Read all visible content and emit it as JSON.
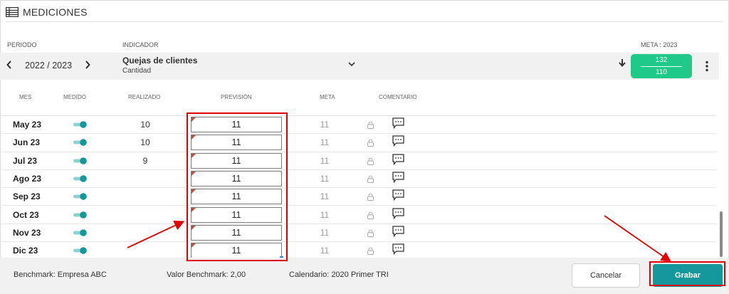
{
  "header": {
    "title": "MEDICIONES",
    "icon": "list-table-icon"
  },
  "labels": {
    "periodo": "PERIODO",
    "indicador": "INDICADOR",
    "meta": "META : 2023"
  },
  "selector": {
    "period": "2022 / 2023",
    "indicator_name": "Quejas de clientes",
    "indicator_unit": "Cantidad",
    "meta_top": "132",
    "meta_bottom": "110"
  },
  "columns": {
    "mes": "MES",
    "medido": "MEDIDO",
    "realizado": "REALIZADO",
    "prevision": "PREVISIÓN",
    "meta": "META",
    "comentario": "COMENTARIO"
  },
  "rows": [
    {
      "mes": "May 23",
      "realizado": "10",
      "prevision": "11",
      "meta": "11"
    },
    {
      "mes": "Jun 23",
      "realizado": "10",
      "prevision": "11",
      "meta": "11"
    },
    {
      "mes": "Jul 23",
      "realizado": "9",
      "prevision": "11",
      "meta": "11"
    },
    {
      "mes": "Ago 23",
      "realizado": "",
      "prevision": "11",
      "meta": "11"
    },
    {
      "mes": "Sep 23",
      "realizado": "",
      "prevision": "11",
      "meta": "11"
    },
    {
      "mes": "Oct 23",
      "realizado": "",
      "prevision": "11",
      "meta": "11"
    },
    {
      "mes": "Nov 23",
      "realizado": "",
      "prevision": "11",
      "meta": "11"
    },
    {
      "mes": "Dic 23",
      "realizado": "",
      "prevision": "11",
      "meta": "11"
    }
  ],
  "footer": {
    "benchmark": "Benchmark: Empresa ABC",
    "valor_benchmark": "Valor Benchmark: 2,00",
    "calendario": "Calendario:   2020 Primer TRI",
    "cancel": "Cancelar",
    "save": "Grabar"
  },
  "colors": {
    "accent": "#15979b",
    "meta_badge": "#1ec98a",
    "annotation": "#e00000",
    "toggle_on": "#15979b"
  }
}
